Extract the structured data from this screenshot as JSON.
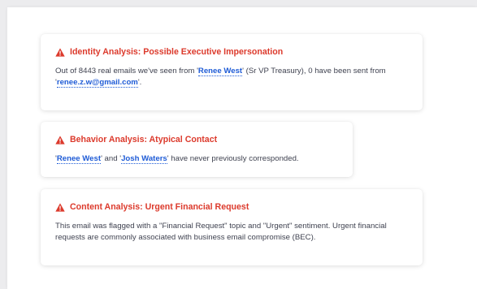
{
  "colors": {
    "alert_red": "#dc3a2c",
    "link_blue": "#1e5bd6",
    "body_text": "#3f4250"
  },
  "cards": {
    "identity": {
      "icon": "warning-triangle-icon",
      "title": "Identity Analysis: Possible Executive Impersonation",
      "body": {
        "t1": "Out of 8443 real emails we've seen from '",
        "name": "Renee West",
        "t2": "' (Sr VP Treasury), 0 have been sent from '",
        "email": "renee.z.w@gmail.com",
        "t3": "'."
      }
    },
    "behavior": {
      "icon": "warning-triangle-icon",
      "title": "Behavior Analysis: Atypical Contact",
      "body": {
        "t1": "'",
        "name1": "Renee West",
        "t2": "' and '",
        "name2": "Josh Waters",
        "t3": "' have never previously corresponded."
      }
    },
    "content": {
      "icon": "warning-triangle-icon",
      "title": "Content Analysis: Urgent Financial Request",
      "body": "This email was flagged with a \"Financial Request\" topic and \"Urgent\" sentiment. Urgent financial requests are commonly associated with business email compromise (BEC)."
    }
  }
}
